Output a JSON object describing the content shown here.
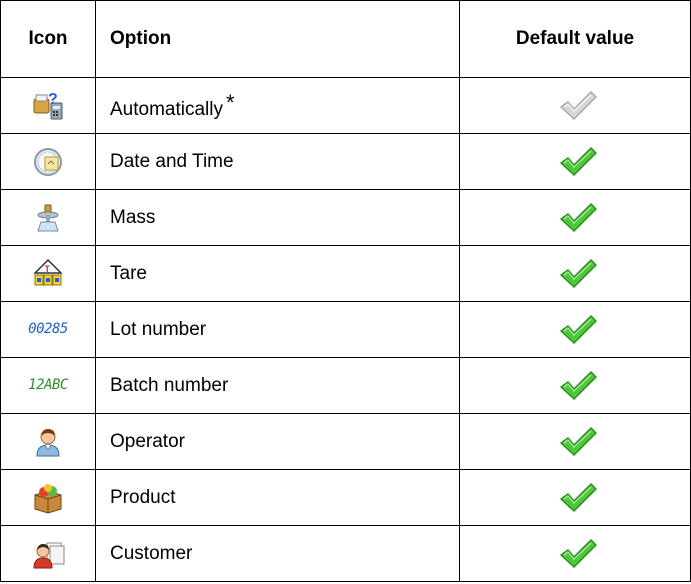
{
  "table": {
    "headers": {
      "icon": "Icon",
      "option": "Option",
      "default_value": "Default value"
    },
    "rows": [
      {
        "icon": "auto-print-icon",
        "option": "Automatically",
        "note": "*",
        "default": "unchecked",
        "check_color": "#c8c8c8"
      },
      {
        "icon": "date-time-icon",
        "option": "Date and Time",
        "default": "checked",
        "check_color": "#3fbf2a"
      },
      {
        "icon": "mass-icon",
        "option": "Mass",
        "default": "checked",
        "check_color": "#3fbf2a"
      },
      {
        "icon": "tare-icon",
        "option": "Tare",
        "default": "checked",
        "check_color": "#3fbf2a"
      },
      {
        "icon": "lot-number-icon",
        "icon_text": "00285",
        "option": "Lot number",
        "default": "checked",
        "check_color": "#3fbf2a"
      },
      {
        "icon": "batch-number-icon",
        "icon_text": "12ABC",
        "option": "Batch number",
        "default": "checked",
        "check_color": "#3fbf2a"
      },
      {
        "icon": "operator-icon",
        "option": "Operator",
        "default": "checked",
        "check_color": "#3fbf2a"
      },
      {
        "icon": "product-icon",
        "option": "Product",
        "default": "checked",
        "check_color": "#3fbf2a"
      },
      {
        "icon": "customer-icon",
        "option": "Customer",
        "default": "checked",
        "check_color": "#3fbf2a"
      }
    ]
  }
}
